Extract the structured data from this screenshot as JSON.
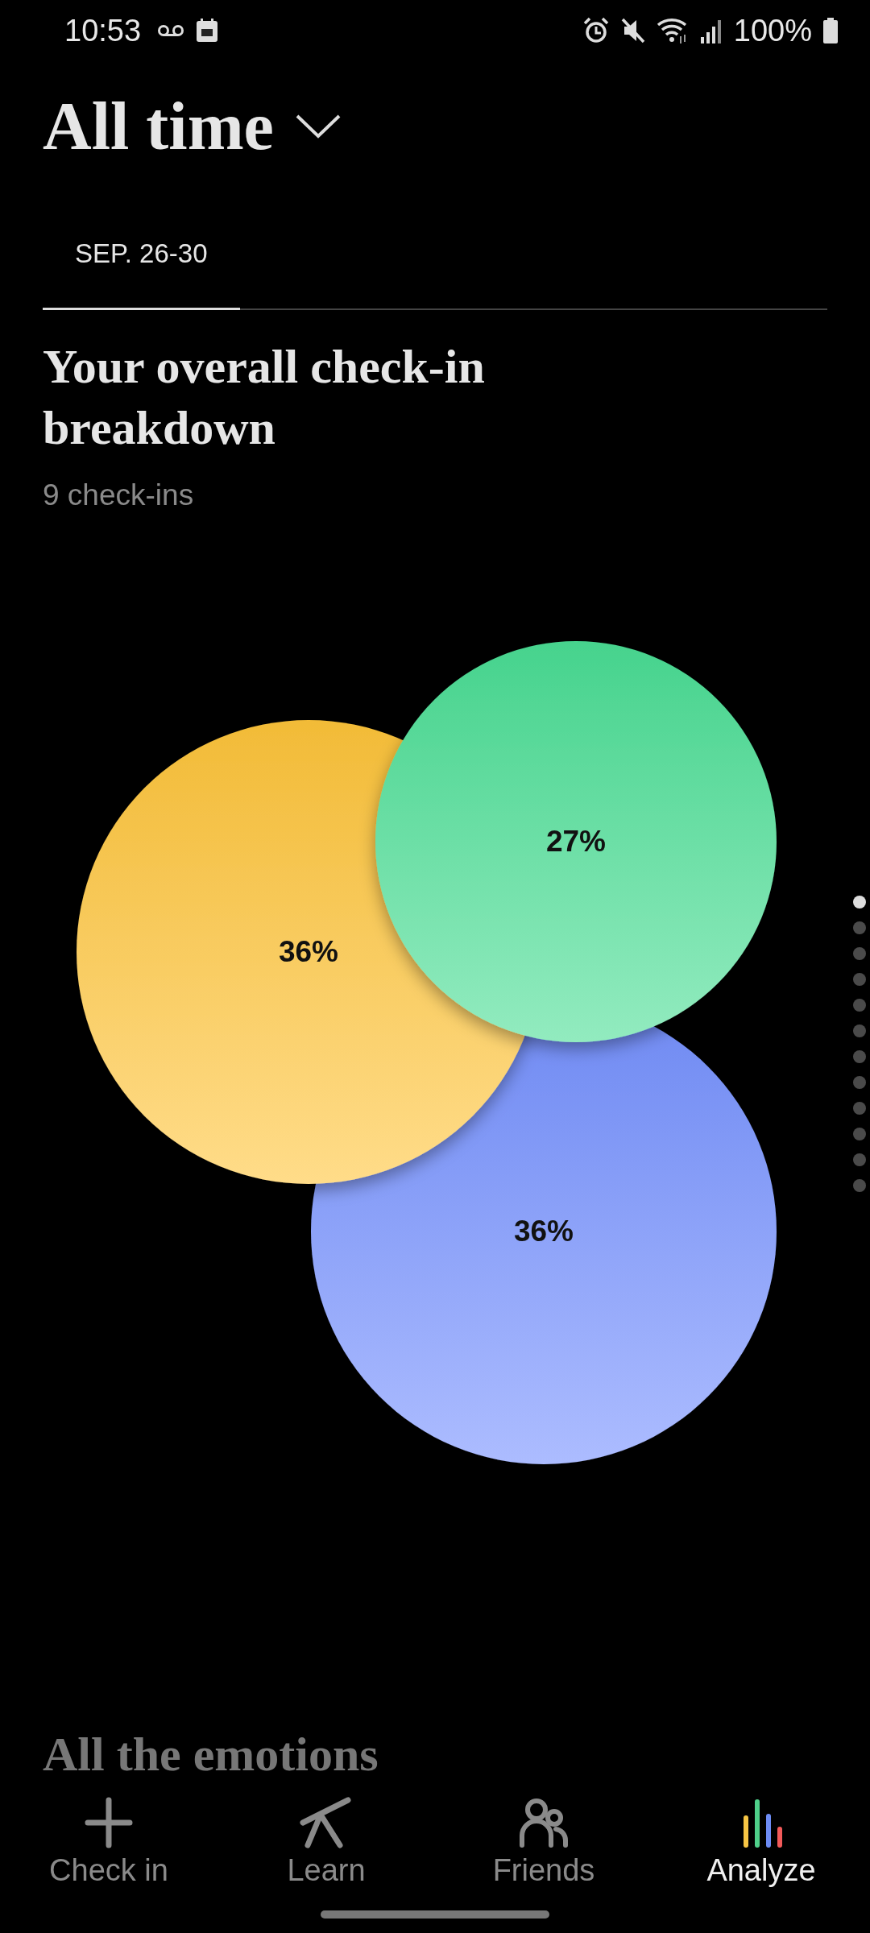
{
  "status_bar": {
    "time": "10:53",
    "battery": "100%"
  },
  "header": {
    "title": "All time"
  },
  "tabs": [
    {
      "label": "SEP. 26-30",
      "selected": true
    }
  ],
  "breakdown": {
    "title": "Your overall check-in breakdown",
    "subtitle": "9 check-ins",
    "bubbles": [
      {
        "label": "36%",
        "color": "#ffc53a"
      },
      {
        "label": "27%",
        "color": "#4ade94"
      },
      {
        "label": "36%",
        "color": "#7490ff"
      }
    ]
  },
  "page_dots": [
    {
      "selected": true
    },
    {
      "selected": false
    },
    {
      "selected": false
    },
    {
      "selected": false
    },
    {
      "selected": false
    },
    {
      "selected": false
    },
    {
      "selected": false
    },
    {
      "selected": false
    },
    {
      "selected": false
    },
    {
      "selected": false
    },
    {
      "selected": false
    },
    {
      "selected": false
    }
  ],
  "next_section": {
    "title": "All the emotions"
  },
  "nav": [
    {
      "kind": "checkin",
      "label": "Check in",
      "selected": false
    },
    {
      "kind": "learn",
      "label": "Learn",
      "selected": false
    },
    {
      "kind": "friends",
      "label": "Friends",
      "selected": false
    },
    {
      "kind": "analyze",
      "label": "Analyze",
      "selected": true
    }
  ]
}
